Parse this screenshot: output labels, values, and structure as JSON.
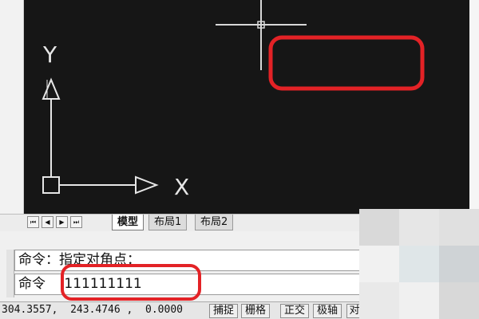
{
  "canvas": {
    "background": "#161616",
    "axis_color": "#e6e6e6",
    "highlight_color": "#e32226",
    "y_axis_label": "Y",
    "x_axis_label": "X"
  },
  "tabs": {
    "nav": [
      "⏮",
      "◀",
      "▶",
      "⏭"
    ],
    "items": [
      {
        "label": "模型",
        "active": true
      },
      {
        "label": "布局1",
        "active": false
      },
      {
        "label": "布局2",
        "active": false
      }
    ]
  },
  "command": {
    "history_line": "命令：指定对角点：",
    "prompt": "命令",
    "input_value": "111111111"
  },
  "status": {
    "coordinates": "304.3557,  243.4746 ,  0.0000",
    "buttons": [
      "捕捉",
      "栅格",
      "正交",
      "极轴",
      "对"
    ]
  }
}
